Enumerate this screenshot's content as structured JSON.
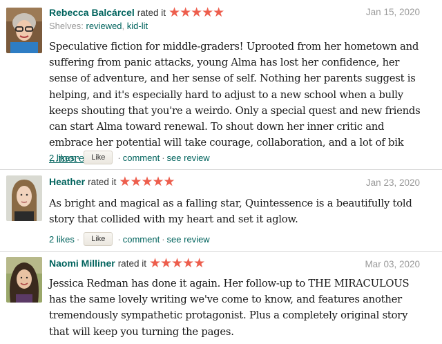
{
  "reviews": [
    {
      "name": "Rebecca Balcárcel",
      "rated_label": "rated it",
      "stars": "★★★★★",
      "date": "Jan 15, 2020",
      "shelves_label": "Shelves:",
      "shelves": [
        "reviewed",
        "kid-lit"
      ],
      "text": "Speculative fiction for middle-graders! Uprooted from her hometown and suffering from panic attacks, young Alma has lost her confidence, her sense of adventure, and her sense of self. Nothing her parents suggest is helping, and it's especially hard to adjust to a new school when a bully keeps shouting that you're a weirdo. Only a special quest and new friends can start Alma toward renewal. To shout down her inner critic and embrace her potential will take courage, collaboration, and a lot of bik",
      "more_label": "...more",
      "likes": "2 likes",
      "like_button": "Like",
      "comment": "comment",
      "see_review": "see review"
    },
    {
      "name": "Heather",
      "rated_label": "rated it",
      "stars": "★★★★★",
      "date": "Jan 23, 2020",
      "text": "As bright and magical as a falling star, Quintessence is a beautifully told story that collided with my heart and set it aglow.",
      "likes": "2 likes",
      "like_button": "Like",
      "comment": "comment",
      "see_review": "see review"
    },
    {
      "name": "Naomi Milliner",
      "rated_label": "rated it",
      "stars": "★★★★★",
      "date": "Mar 03, 2020",
      "text": "Jessica Redman has done it again. Her follow-up to THE MIRACULOUS has the same lovely writing we've come to know, and features another tremendously sympathetic protagonist. Plus a completely original story that will keep you turning the pages."
    }
  ],
  "separators": {
    "dot": "·",
    "comma": ","
  },
  "colors": {
    "link": "#00635d",
    "star": "#ed5e4d",
    "muted": "#999999"
  }
}
